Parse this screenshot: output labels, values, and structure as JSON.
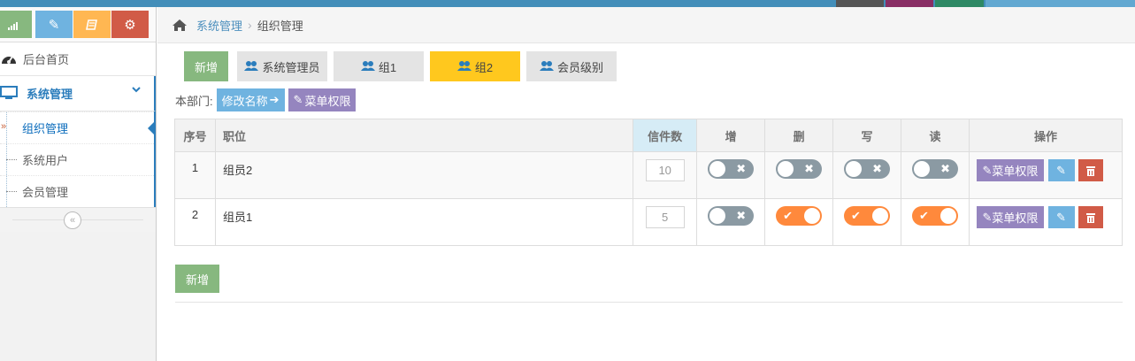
{
  "colors": {
    "brand_blue": "#438eb9",
    "green": "#87b87f",
    "purple": "#9585bf",
    "light_blue": "#6fb3e0",
    "red": "#d15b47",
    "yellow": "#ffb752",
    "active_tab": "#ffc81e",
    "switch_on": "#ff893c",
    "switch_off": "#8b9aa3"
  },
  "shortcuts": [
    {
      "icon": "signal-icon"
    },
    {
      "icon": "pencil-icon"
    },
    {
      "icon": "book-icon"
    },
    {
      "icon": "cogs-icon"
    }
  ],
  "sidebar": {
    "home": "后台首页",
    "system_menu": "系统管理",
    "sub_items": [
      "组织管理",
      "系统用户",
      "会员管理"
    ],
    "collapse_glyph": "«"
  },
  "breadcrumb": {
    "link": "系统管理",
    "current": "组织管理"
  },
  "tabs": {
    "add": "新增",
    "items": [
      "系统管理员",
      "组1",
      "组2",
      "会员级别"
    ],
    "active_index": 2
  },
  "dept": {
    "label": "本部门:",
    "rename": "修改名称",
    "menu_perm": "菜单权限"
  },
  "table": {
    "headers": [
      "序号",
      "职位",
      "信件数",
      "增",
      "删",
      "写",
      "读",
      "操作"
    ],
    "rows": [
      {
        "idx": "1",
        "name": "组员2",
        "count": "10",
        "add": false,
        "del": false,
        "write": false,
        "read": false
      },
      {
        "idx": "2",
        "name": "组员1",
        "count": "5",
        "add": false,
        "del": true,
        "write": true,
        "read": true
      }
    ],
    "row_action": "菜单权限"
  },
  "footer": {
    "add": "新增"
  }
}
